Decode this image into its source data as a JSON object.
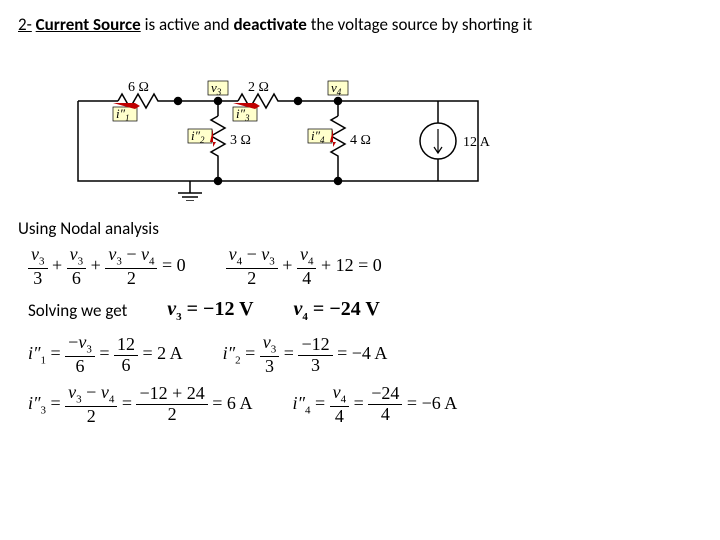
{
  "title": {
    "prefix": "2-",
    "b1": "Current Source",
    "t1": " is active and ",
    "b2": "deactivate",
    "t2": " the voltage source by shorting it"
  },
  "circuit": {
    "r1": "6 Ω",
    "r2": "2 Ω",
    "r3": "3 Ω",
    "r4": "4 Ω",
    "v3": "v",
    "v3s": "3",
    "v4": "v",
    "v4s": "4",
    "i1": "i″",
    "i1s": "1",
    "i2": "i″",
    "i2s": "2",
    "i3": "i″",
    "i3s": "3",
    "i4": "i″",
    "i4s": "4",
    "isrc": "12 A"
  },
  "nodal_label": "Using Nodal analysis",
  "eq1": {
    "a_num": "v3",
    "a_den": "3",
    "plus1": "+",
    "b_num": "v3",
    "b_den": "6",
    "plus2": "+",
    "c_num": "v3 − v4",
    "c_den": "2",
    "eqz": "= 0"
  },
  "eq2": {
    "a_num": "v4 − v3",
    "a_den": "2",
    "plus1": "+",
    "b_num": "v4",
    "b_den": "4",
    "plus2": "+ 12 = 0"
  },
  "solving_label": "Solving we get",
  "sol": {
    "v3": "v3 = −12 V",
    "v4": "v4 = −24 V"
  },
  "i1": {
    "lhs": "i″1 =",
    "a_num": "−v3",
    "a_den": "6",
    "eq1": "=",
    "b_num": "12",
    "b_den": "6",
    "rhs": "= 2 A"
  },
  "i2": {
    "lhs": "i″2 =",
    "a_num": "v3",
    "a_den": "3",
    "eq1": "=",
    "b_num": "−12",
    "b_den": "3",
    "rhs": "= −4 A"
  },
  "i3": {
    "lhs": "i″3 =",
    "a_num": "v3 − v4",
    "a_den": "2",
    "eq1": "=",
    "b_num": "−12 + 24",
    "b_den": "2",
    "rhs": "= 6 A"
  },
  "i4": {
    "lhs": "i″4 =",
    "a_num": "v4",
    "a_den": "4",
    "eq1": "=",
    "b_num": "−24",
    "b_den": "4",
    "rhs": "= −6 A"
  }
}
